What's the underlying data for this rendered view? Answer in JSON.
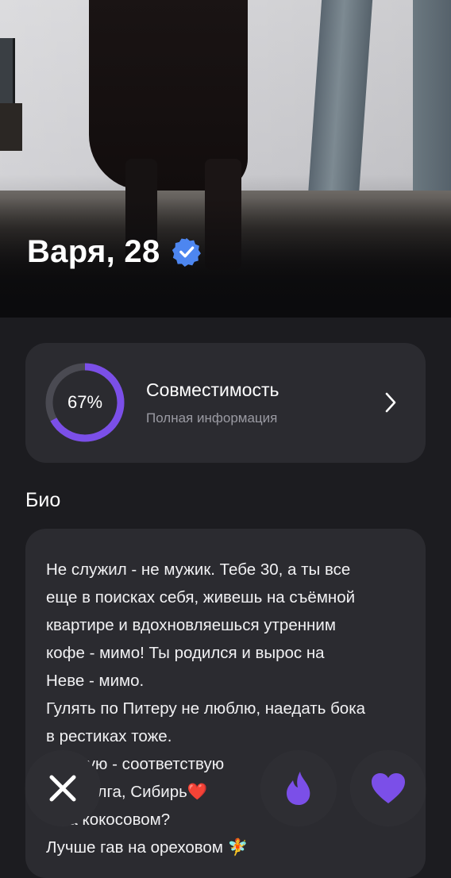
{
  "profile": {
    "name_age": "Варя, 28",
    "verified": true
  },
  "compatibility": {
    "percent_label": "67%",
    "percent_value": 0.67,
    "title": "Совместимость",
    "subtitle": "Полная информация"
  },
  "bio": {
    "heading": "Био",
    "lines": [
      "Не служил - не мужик. Тебе 30, а ты все",
      "еще в поисках себя, живешь на съёмной",
      "квартире и вдохновляешься утренним",
      "кофе - мимо! Ты родился и вырос на",
      "Неве - мимо.",
      "Гулять по Питеру не люблю, наедать бока",
      "в рестиках тоже.",
      "   ендую - соответствую",
      "       Волга, Сибирь❤️",
      "   на кокосовом?",
      "Лучше гав на ореховом 🧚"
    ]
  },
  "actions": {
    "dismiss_icon": "close-icon",
    "boost_icon": "flame-icon",
    "like_icon": "heart-icon"
  },
  "colors": {
    "accent": "#7b4fe8",
    "verified": "#4d86f0",
    "card": "#2b2b30",
    "background": "#1c1c20"
  }
}
